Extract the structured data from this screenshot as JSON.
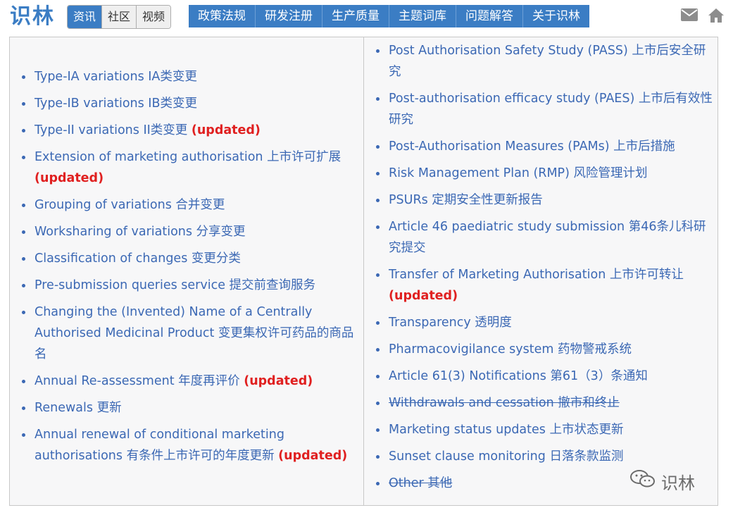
{
  "header": {
    "logo": "识林",
    "tabs": [
      {
        "label": "资讯",
        "active": true
      },
      {
        "label": "社区",
        "active": false
      },
      {
        "label": "视频",
        "active": false
      }
    ],
    "menu": [
      "政策法规",
      "研发注册",
      "生产质量",
      "主题词库",
      "问题解答",
      "关于识林"
    ],
    "icons": [
      "envelope-icon",
      "home-icon"
    ]
  },
  "left_list": [
    {
      "text": "Type-IA variations IA类变更",
      "updated": ""
    },
    {
      "text": "Type-IB variations IB类变更",
      "updated": ""
    },
    {
      "text": "Type-II variations II类变更 ",
      "updated": "(updated)"
    },
    {
      "text": "Extension of marketing authorisation 上市许可扩展 ",
      "updated": "(updated)"
    },
    {
      "text": "Grouping of variations 合并变更",
      "updated": ""
    },
    {
      "text": "Worksharing of variations 分享变更",
      "updated": ""
    },
    {
      "text": "Classification of changes 变更分类",
      "updated": ""
    },
    {
      "text": "Pre-submission queries service 提交前查询服务",
      "updated": ""
    },
    {
      "text": "Changing the (Invented) Name of a Centrally Authorised Medicinal Product 变更集权许可药品的商品名",
      "updated": ""
    },
    {
      "text": "Annual Re-assessment 年度再评价 ",
      "updated": "(updated)"
    },
    {
      "text": "Renewals 更新",
      "updated": ""
    },
    {
      "text": "Annual renewal of conditional marketing authorisations 有条件上市许可的年度更新 ",
      "updated": "(updated)"
    }
  ],
  "right_list": [
    {
      "text": "Post Authorisation Safety Study (PASS) 上市后安全研究",
      "updated": ""
    },
    {
      "text": "Post-authorisation efficacy study (PAES) 上市后有效性研究",
      "updated": ""
    },
    {
      "text": "Post-Authorisation Measures (PAMs) 上市后措施",
      "updated": ""
    },
    {
      "text": "Risk Management Plan (RMP) 风险管理计划",
      "updated": ""
    },
    {
      "text": "PSURs 定期安全性更新报告",
      "updated": ""
    },
    {
      "text": "Article 46 paediatric study submission 第46条儿科研究提交",
      "updated": ""
    },
    {
      "text": "Transfer of Marketing Authorisation 上市许可转让 ",
      "updated": "(updated)"
    },
    {
      "text": "Transparency 透明度",
      "updated": ""
    },
    {
      "text": "Pharmacovigilance system 药物警戒系统",
      "updated": ""
    },
    {
      "text": "Article 61(3) Notifications 第61（3）条通知",
      "updated": ""
    },
    {
      "text": "Withdrawals and cessation 撤市和终止",
      "updated": "",
      "strike": true
    },
    {
      "text": "Marketing status updates 上市状态更新",
      "updated": ""
    },
    {
      "text": "Sunset clause monitoring 日落条款监测",
      "updated": ""
    },
    {
      "text": "Other 其他",
      "updated": "",
      "strike": true
    }
  ],
  "watermark": {
    "text": "识林",
    "icon": "wechat-icon"
  },
  "colors": {
    "brand": "#3b7dc4",
    "link": "#3b68b4",
    "updated": "#e02020",
    "panel_bg": "#f7f7f8"
  }
}
